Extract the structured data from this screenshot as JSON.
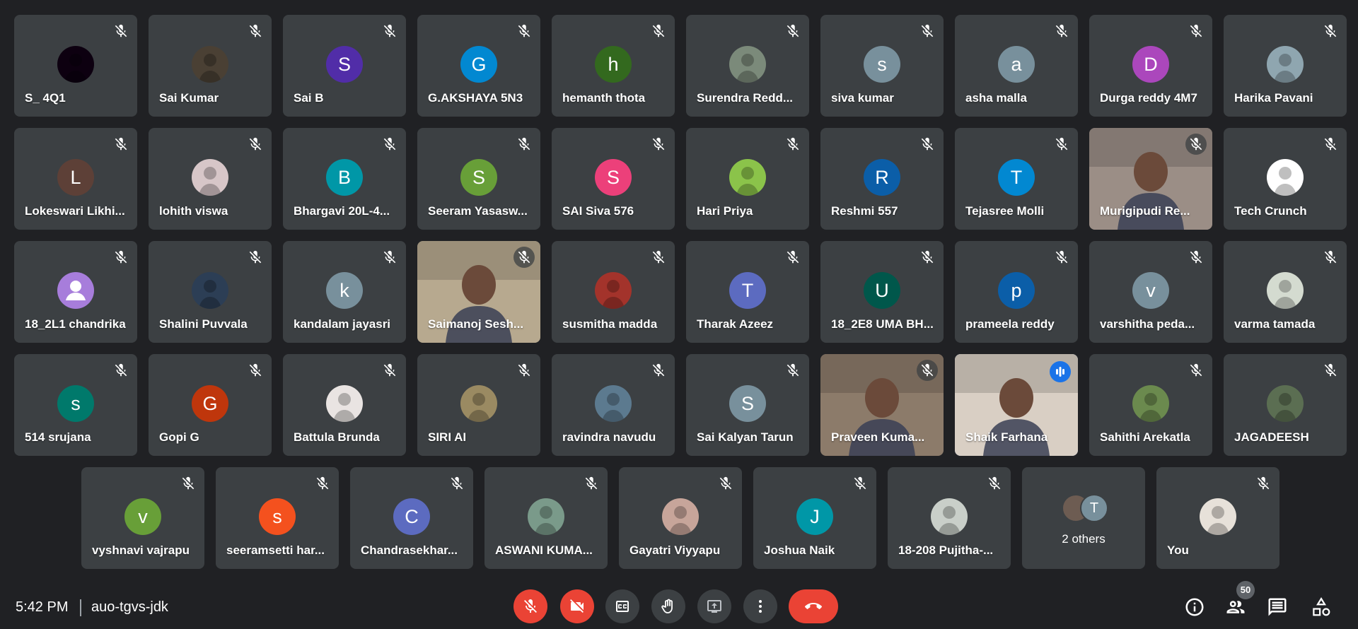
{
  "colors": {
    "background": "#202124",
    "tile": "#3c4043",
    "end_call": "#ea4335",
    "speaking_outline": "#8ab4f8"
  },
  "participants": [
    {
      "name": "S_ 4Q1",
      "avatar": {
        "kind": "photo",
        "color": "#0d0010"
      }
    },
    {
      "name": "Sai Kumar",
      "avatar": {
        "kind": "photo",
        "color": "#4a4034"
      }
    },
    {
      "name": "Sai B",
      "avatar": {
        "kind": "letter",
        "letter": "S",
        "color": "#512da8"
      }
    },
    {
      "name": "G.AKSHAYA 5N3",
      "avatar": {
        "kind": "letter",
        "letter": "G",
        "color": "#0288d1"
      }
    },
    {
      "name": "hemanth thota",
      "avatar": {
        "kind": "letter",
        "letter": "h",
        "color": "#33691e"
      }
    },
    {
      "name": "Surendra Redd...",
      "avatar": {
        "kind": "photo",
        "color": "#7b8a7a"
      }
    },
    {
      "name": "siva kumar",
      "avatar": {
        "kind": "letter",
        "letter": "s",
        "color": "#78909c"
      }
    },
    {
      "name": "asha malla",
      "avatar": {
        "kind": "letter",
        "letter": "a",
        "color": "#78909c"
      }
    },
    {
      "name": "Durga reddy 4M7",
      "avatar": {
        "kind": "letter",
        "letter": "D",
        "color": "#ab47bc"
      }
    },
    {
      "name": "Harika Pavani",
      "avatar": {
        "kind": "photo",
        "color": "#8fa6b0"
      }
    },
    {
      "name": "Lokeswari Likhi...",
      "avatar": {
        "kind": "letter",
        "letter": "L",
        "color": "#5d4037"
      }
    },
    {
      "name": "lohith viswa",
      "avatar": {
        "kind": "photo",
        "color": "#d7c6c8"
      }
    },
    {
      "name": "Bhargavi 20L-4...",
      "avatar": {
        "kind": "letter",
        "letter": "B",
        "color": "#0097a7"
      }
    },
    {
      "name": "Seeram Yasasw...",
      "avatar": {
        "kind": "letter",
        "letter": "S",
        "color": "#689f38"
      }
    },
    {
      "name": "SAI Siva 576",
      "avatar": {
        "kind": "letter",
        "letter": "S",
        "color": "#ec407a"
      }
    },
    {
      "name": "Hari Priya",
      "avatar": {
        "kind": "photo",
        "color": "#8bc34a"
      }
    },
    {
      "name": "Reshmi 557",
      "avatar": {
        "kind": "letter",
        "letter": "R",
        "color": "#0b5ea8"
      }
    },
    {
      "name": "Tejasree Molli",
      "avatar": {
        "kind": "letter",
        "letter": "T",
        "color": "#0288d1"
      }
    },
    {
      "name": "Murigipudi Re...",
      "avatar": {
        "kind": "video",
        "color": "#9b8e86"
      },
      "video": true
    },
    {
      "name": "Tech Crunch",
      "avatar": {
        "kind": "photo",
        "color": "#ffffff"
      }
    },
    {
      "name": "18_2L1 chandrika",
      "avatar": {
        "kind": "generic",
        "color": "#a77ddb"
      }
    },
    {
      "name": "Shalini Puvvala",
      "avatar": {
        "kind": "photo",
        "color": "#2c3e55"
      }
    },
    {
      "name": "kandalam jayasri",
      "avatar": {
        "kind": "letter",
        "letter": "k",
        "color": "#78909c"
      }
    },
    {
      "name": "Saimanoj Sesh...",
      "avatar": {
        "kind": "video",
        "color": "#b7a98f"
      },
      "video": true
    },
    {
      "name": "susmitha madda",
      "avatar": {
        "kind": "photo",
        "color": "#a3332b"
      }
    },
    {
      "name": "Tharak Azeez",
      "avatar": {
        "kind": "letter",
        "letter": "T",
        "color": "#5c6bc0"
      }
    },
    {
      "name": "18_2E8 UMA BH...",
      "avatar": {
        "kind": "letter",
        "letter": "U",
        "color": "#00574b"
      }
    },
    {
      "name": "prameela reddy",
      "avatar": {
        "kind": "letter",
        "letter": "p",
        "color": "#0b5ea8"
      }
    },
    {
      "name": "varshitha peda...",
      "avatar": {
        "kind": "letter",
        "letter": "v",
        "color": "#78909c"
      }
    },
    {
      "name": "varma tamada",
      "avatar": {
        "kind": "photo",
        "color": "#d4dbd0"
      }
    },
    {
      "name": "514 srujana",
      "avatar": {
        "kind": "letter",
        "letter": "s",
        "color": "#00796b"
      }
    },
    {
      "name": "Gopi G",
      "avatar": {
        "kind": "letter",
        "letter": "G",
        "color": "#bf360c"
      }
    },
    {
      "name": "Battula Brunda",
      "avatar": {
        "kind": "photo",
        "color": "#e9e4e2"
      }
    },
    {
      "name": "SIRI AI",
      "avatar": {
        "kind": "photo",
        "color": "#9a8a62"
      }
    },
    {
      "name": "ravindra navudu",
      "avatar": {
        "kind": "photo",
        "color": "#5c7a8f"
      }
    },
    {
      "name": "Sai Kalyan Tarun",
      "avatar": {
        "kind": "letter",
        "letter": "S",
        "color": "#78909c"
      }
    },
    {
      "name": "Praveen Kuma...",
      "avatar": {
        "kind": "video",
        "color": "#8c7b6a"
      },
      "video": true
    },
    {
      "name": "Shaik Farhana",
      "avatar": {
        "kind": "video",
        "color": "#d9cfc4"
      },
      "video": true,
      "speaking": true
    },
    {
      "name": "Sahithi Arekatla",
      "avatar": {
        "kind": "photo",
        "color": "#6b8a4e"
      }
    },
    {
      "name": "JAGADEESH",
      "avatar": {
        "kind": "photo",
        "color": "#5b6e52"
      }
    },
    {
      "name": "vyshnavi vajrapu",
      "avatar": {
        "kind": "letter",
        "letter": "v",
        "color": "#689f38"
      }
    },
    {
      "name": "seeramsetti har...",
      "avatar": {
        "kind": "letter",
        "letter": "s",
        "color": "#f4511e"
      }
    },
    {
      "name": "Chandrasekhar...",
      "avatar": {
        "kind": "letter",
        "letter": "C",
        "color": "#5c6bc0"
      }
    },
    {
      "name": "ASWANI KUMA...",
      "avatar": {
        "kind": "photo",
        "color": "#7a9a8a"
      }
    },
    {
      "name": "Gayatri Viyyapu",
      "avatar": {
        "kind": "photo",
        "color": "#c7a59a"
      }
    },
    {
      "name": "Joshua Naik",
      "avatar": {
        "kind": "letter",
        "letter": "J",
        "color": "#0097a7"
      }
    },
    {
      "name": "18-208 Pujitha-...",
      "avatar": {
        "kind": "photo",
        "color": "#c9cfc9"
      }
    },
    {
      "name": "2 others",
      "avatar": {
        "kind": "others",
        "letter": "T",
        "color": "#78909c"
      },
      "others": true
    },
    {
      "name": "You",
      "avatar": {
        "kind": "photo",
        "color": "#e7e1d9"
      }
    }
  ],
  "bottom_bar": {
    "time": "5:42 PM",
    "meeting_code": "auo-tgvs-jdk",
    "participant_count": "50",
    "controls": [
      {
        "name": "mic-off-button",
        "icon": "mic-off-icon"
      },
      {
        "name": "camera-off-button",
        "icon": "videocam-off-icon"
      },
      {
        "name": "captions-button",
        "icon": "closed-captions-icon"
      },
      {
        "name": "raise-hand-button",
        "icon": "hand-icon"
      },
      {
        "name": "present-button",
        "icon": "present-screen-icon"
      },
      {
        "name": "more-options-button",
        "icon": "more-vert-icon"
      },
      {
        "name": "end-call-button",
        "icon": "call-end-icon"
      }
    ],
    "right_icons": [
      "info-icon",
      "people-icon",
      "chat-icon",
      "activities-icon"
    ]
  }
}
